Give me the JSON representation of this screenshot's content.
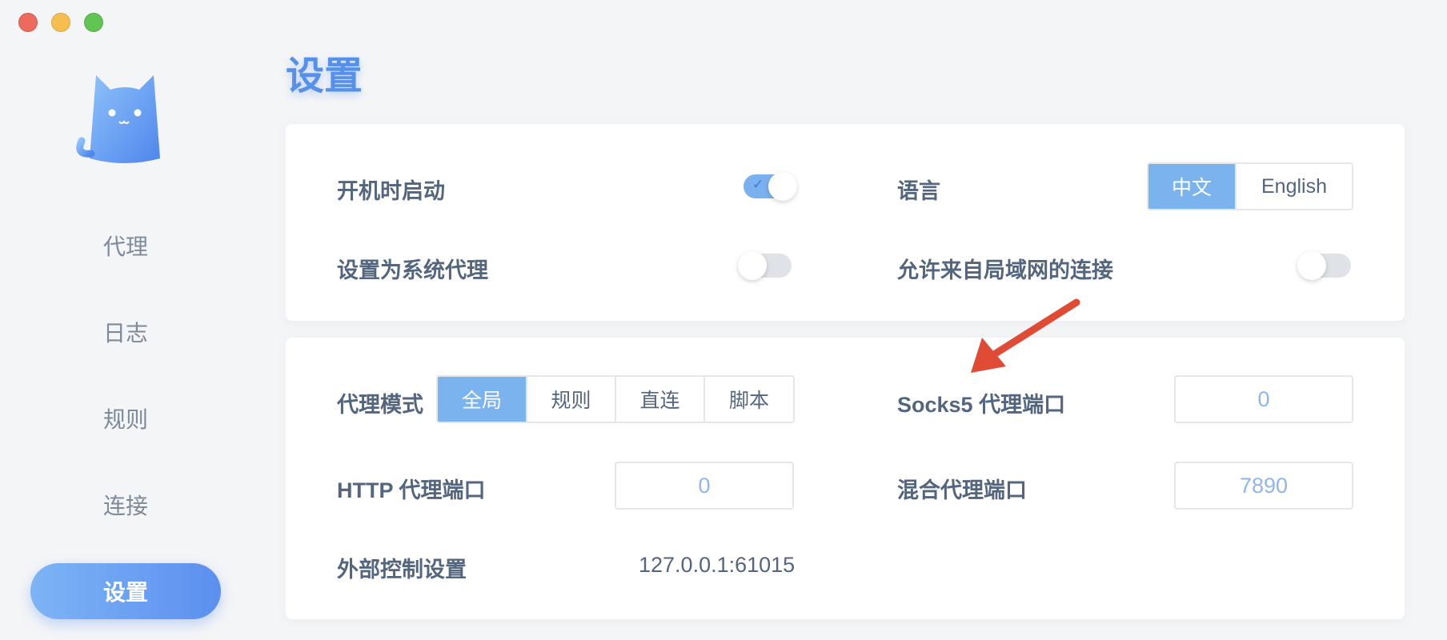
{
  "window": {
    "traffic_lights": [
      "close",
      "minimize",
      "zoom"
    ]
  },
  "sidebar": {
    "logo_icon": "cat-logo-icon",
    "items": [
      {
        "label": "代理",
        "active": false
      },
      {
        "label": "日志",
        "active": false
      },
      {
        "label": "规则",
        "active": false
      },
      {
        "label": "连接",
        "active": false
      },
      {
        "label": "设置",
        "active": true
      }
    ]
  },
  "main": {
    "title": "设置",
    "general": {
      "launch_at_login": {
        "label": "开机时启动",
        "enabled": true
      },
      "system_proxy": {
        "label": "设置为系统代理",
        "enabled": false
      },
      "language": {
        "label": "语言",
        "options": [
          "中文",
          "English"
        ],
        "selected": "中文"
      },
      "allow_lan": {
        "label": "允许来自局域网的连接",
        "enabled": false
      }
    },
    "proxy": {
      "mode": {
        "label": "代理模式",
        "options": [
          "全局",
          "规则",
          "直连",
          "脚本"
        ],
        "selected": "全局"
      },
      "socks5_port": {
        "label": "Socks5 代理端口",
        "value": "0"
      },
      "http_port": {
        "label": "HTTP 代理端口",
        "value": "0"
      },
      "mixed_port": {
        "label": "混合代理端口",
        "value": "7890"
      },
      "external_controller": {
        "label": "外部控制设置",
        "value": "127.0.0.1:61015"
      }
    }
  },
  "colors": {
    "accent": "#5590ea",
    "annotation_arrow": "#e04b35"
  }
}
